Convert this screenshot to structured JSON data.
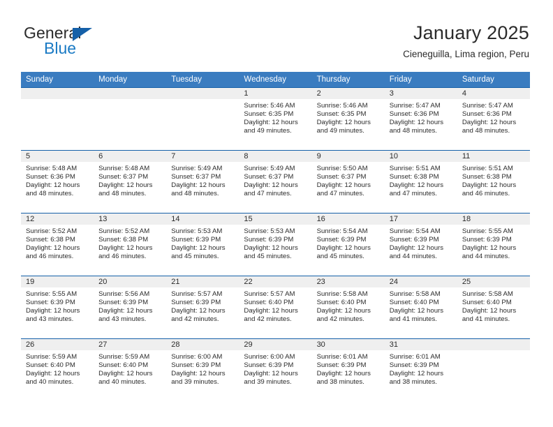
{
  "brand": {
    "name_part1": "General",
    "name_part2": "Blue",
    "triangle_color": "#1560a8",
    "blue_color": "#1a7ac4"
  },
  "header": {
    "title": "January 2025",
    "subtitle": "Cieneguilla, Lima region, Peru"
  },
  "theme": {
    "header_row_bg": "#3a7cc0",
    "daynum_band_bg": "#efefef",
    "row_divider": "#1560a8",
    "text": "#2b2b2b"
  },
  "columns": [
    "Sunday",
    "Monday",
    "Tuesday",
    "Wednesday",
    "Thursday",
    "Friday",
    "Saturday"
  ],
  "weeks": [
    [
      {
        "day": "",
        "empty": true
      },
      {
        "day": "",
        "empty": true
      },
      {
        "day": "",
        "empty": true
      },
      {
        "day": "1",
        "sunrise": "Sunrise: 5:46 AM",
        "sunset": "Sunset: 6:35 PM",
        "daylight": "Daylight: 12 hours and 49 minutes."
      },
      {
        "day": "2",
        "sunrise": "Sunrise: 5:46 AM",
        "sunset": "Sunset: 6:35 PM",
        "daylight": "Daylight: 12 hours and 49 minutes."
      },
      {
        "day": "3",
        "sunrise": "Sunrise: 5:47 AM",
        "sunset": "Sunset: 6:36 PM",
        "daylight": "Daylight: 12 hours and 48 minutes."
      },
      {
        "day": "4",
        "sunrise": "Sunrise: 5:47 AM",
        "sunset": "Sunset: 6:36 PM",
        "daylight": "Daylight: 12 hours and 48 minutes."
      }
    ],
    [
      {
        "day": "5",
        "sunrise": "Sunrise: 5:48 AM",
        "sunset": "Sunset: 6:36 PM",
        "daylight": "Daylight: 12 hours and 48 minutes."
      },
      {
        "day": "6",
        "sunrise": "Sunrise: 5:48 AM",
        "sunset": "Sunset: 6:37 PM",
        "daylight": "Daylight: 12 hours and 48 minutes."
      },
      {
        "day": "7",
        "sunrise": "Sunrise: 5:49 AM",
        "sunset": "Sunset: 6:37 PM",
        "daylight": "Daylight: 12 hours and 48 minutes."
      },
      {
        "day": "8",
        "sunrise": "Sunrise: 5:49 AM",
        "sunset": "Sunset: 6:37 PM",
        "daylight": "Daylight: 12 hours and 47 minutes."
      },
      {
        "day": "9",
        "sunrise": "Sunrise: 5:50 AM",
        "sunset": "Sunset: 6:37 PM",
        "daylight": "Daylight: 12 hours and 47 minutes."
      },
      {
        "day": "10",
        "sunrise": "Sunrise: 5:51 AM",
        "sunset": "Sunset: 6:38 PM",
        "daylight": "Daylight: 12 hours and 47 minutes."
      },
      {
        "day": "11",
        "sunrise": "Sunrise: 5:51 AM",
        "sunset": "Sunset: 6:38 PM",
        "daylight": "Daylight: 12 hours and 46 minutes."
      }
    ],
    [
      {
        "day": "12",
        "sunrise": "Sunrise: 5:52 AM",
        "sunset": "Sunset: 6:38 PM",
        "daylight": "Daylight: 12 hours and 46 minutes."
      },
      {
        "day": "13",
        "sunrise": "Sunrise: 5:52 AM",
        "sunset": "Sunset: 6:38 PM",
        "daylight": "Daylight: 12 hours and 46 minutes."
      },
      {
        "day": "14",
        "sunrise": "Sunrise: 5:53 AM",
        "sunset": "Sunset: 6:39 PM",
        "daylight": "Daylight: 12 hours and 45 minutes."
      },
      {
        "day": "15",
        "sunrise": "Sunrise: 5:53 AM",
        "sunset": "Sunset: 6:39 PM",
        "daylight": "Daylight: 12 hours and 45 minutes."
      },
      {
        "day": "16",
        "sunrise": "Sunrise: 5:54 AM",
        "sunset": "Sunset: 6:39 PM",
        "daylight": "Daylight: 12 hours and 45 minutes."
      },
      {
        "day": "17",
        "sunrise": "Sunrise: 5:54 AM",
        "sunset": "Sunset: 6:39 PM",
        "daylight": "Daylight: 12 hours and 44 minutes."
      },
      {
        "day": "18",
        "sunrise": "Sunrise: 5:55 AM",
        "sunset": "Sunset: 6:39 PM",
        "daylight": "Daylight: 12 hours and 44 minutes."
      }
    ],
    [
      {
        "day": "19",
        "sunrise": "Sunrise: 5:55 AM",
        "sunset": "Sunset: 6:39 PM",
        "daylight": "Daylight: 12 hours and 43 minutes."
      },
      {
        "day": "20",
        "sunrise": "Sunrise: 5:56 AM",
        "sunset": "Sunset: 6:39 PM",
        "daylight": "Daylight: 12 hours and 43 minutes."
      },
      {
        "day": "21",
        "sunrise": "Sunrise: 5:57 AM",
        "sunset": "Sunset: 6:39 PM",
        "daylight": "Daylight: 12 hours and 42 minutes."
      },
      {
        "day": "22",
        "sunrise": "Sunrise: 5:57 AM",
        "sunset": "Sunset: 6:40 PM",
        "daylight": "Daylight: 12 hours and 42 minutes."
      },
      {
        "day": "23",
        "sunrise": "Sunrise: 5:58 AM",
        "sunset": "Sunset: 6:40 PM",
        "daylight": "Daylight: 12 hours and 42 minutes."
      },
      {
        "day": "24",
        "sunrise": "Sunrise: 5:58 AM",
        "sunset": "Sunset: 6:40 PM",
        "daylight": "Daylight: 12 hours and 41 minutes."
      },
      {
        "day": "25",
        "sunrise": "Sunrise: 5:58 AM",
        "sunset": "Sunset: 6:40 PM",
        "daylight": "Daylight: 12 hours and 41 minutes."
      }
    ],
    [
      {
        "day": "26",
        "sunrise": "Sunrise: 5:59 AM",
        "sunset": "Sunset: 6:40 PM",
        "daylight": "Daylight: 12 hours and 40 minutes."
      },
      {
        "day": "27",
        "sunrise": "Sunrise: 5:59 AM",
        "sunset": "Sunset: 6:40 PM",
        "daylight": "Daylight: 12 hours and 40 minutes."
      },
      {
        "day": "28",
        "sunrise": "Sunrise: 6:00 AM",
        "sunset": "Sunset: 6:39 PM",
        "daylight": "Daylight: 12 hours and 39 minutes."
      },
      {
        "day": "29",
        "sunrise": "Sunrise: 6:00 AM",
        "sunset": "Sunset: 6:39 PM",
        "daylight": "Daylight: 12 hours and 39 minutes."
      },
      {
        "day": "30",
        "sunrise": "Sunrise: 6:01 AM",
        "sunset": "Sunset: 6:39 PM",
        "daylight": "Daylight: 12 hours and 38 minutes."
      },
      {
        "day": "31",
        "sunrise": "Sunrise: 6:01 AM",
        "sunset": "Sunset: 6:39 PM",
        "daylight": "Daylight: 12 hours and 38 minutes."
      },
      {
        "day": "",
        "empty": true
      }
    ]
  ]
}
